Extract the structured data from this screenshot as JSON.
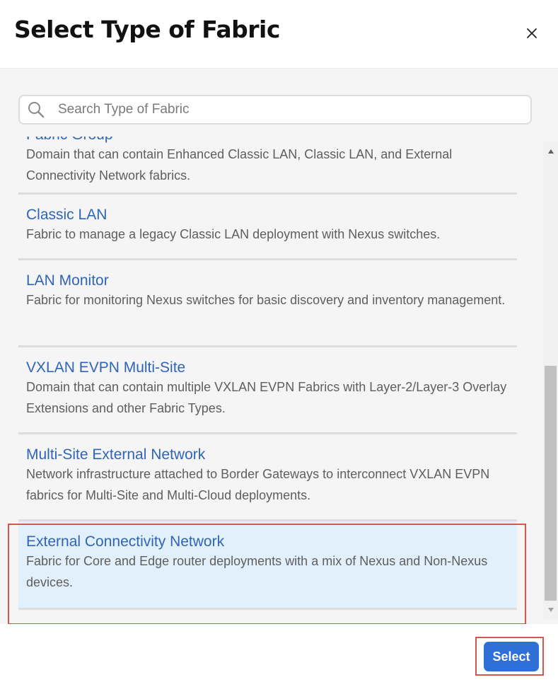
{
  "dialog": {
    "title": "Select Type of Fabric",
    "close_icon": "close-icon"
  },
  "search": {
    "placeholder": "Search Type of Fabric",
    "value": "",
    "icon": "search-icon"
  },
  "fabric_types": [
    {
      "name": "Fabric Group",
      "description": "Domain that can contain Enhanced Classic LAN, Classic LAN, and External Connectivity Network fabrics.",
      "selected": false
    },
    {
      "name": "Classic LAN",
      "description": "Fabric to manage a legacy Classic LAN deployment with Nexus switches.",
      "selected": false
    },
    {
      "name": "LAN Monitor",
      "description": "Fabric for monitoring Nexus switches for basic discovery and inventory management.",
      "selected": false
    },
    {
      "name": "VXLAN EVPN Multi-Site",
      "description": "Domain that can contain multiple VXLAN EVPN Fabrics with Layer-2/Layer-3 Overlay Extensions and other Fabric Types.",
      "selected": false
    },
    {
      "name": "Multi-Site External Network",
      "description": "Network infrastructure attached to Border Gateways to interconnect VXLAN EVPN fabrics for Multi-Site and Multi-Cloud deployments.",
      "selected": false
    },
    {
      "name": "External Connectivity Network",
      "description": "Fabric for Core and Edge router deployments with a mix of Nexus and Non-Nexus devices.",
      "selected": true
    }
  ],
  "footer": {
    "select_label": "Select"
  },
  "colors": {
    "accent": "#2f6fd8",
    "link": "#2f65b8",
    "selected_bg": "#e2f0fb",
    "highlight": "#d9534f"
  }
}
